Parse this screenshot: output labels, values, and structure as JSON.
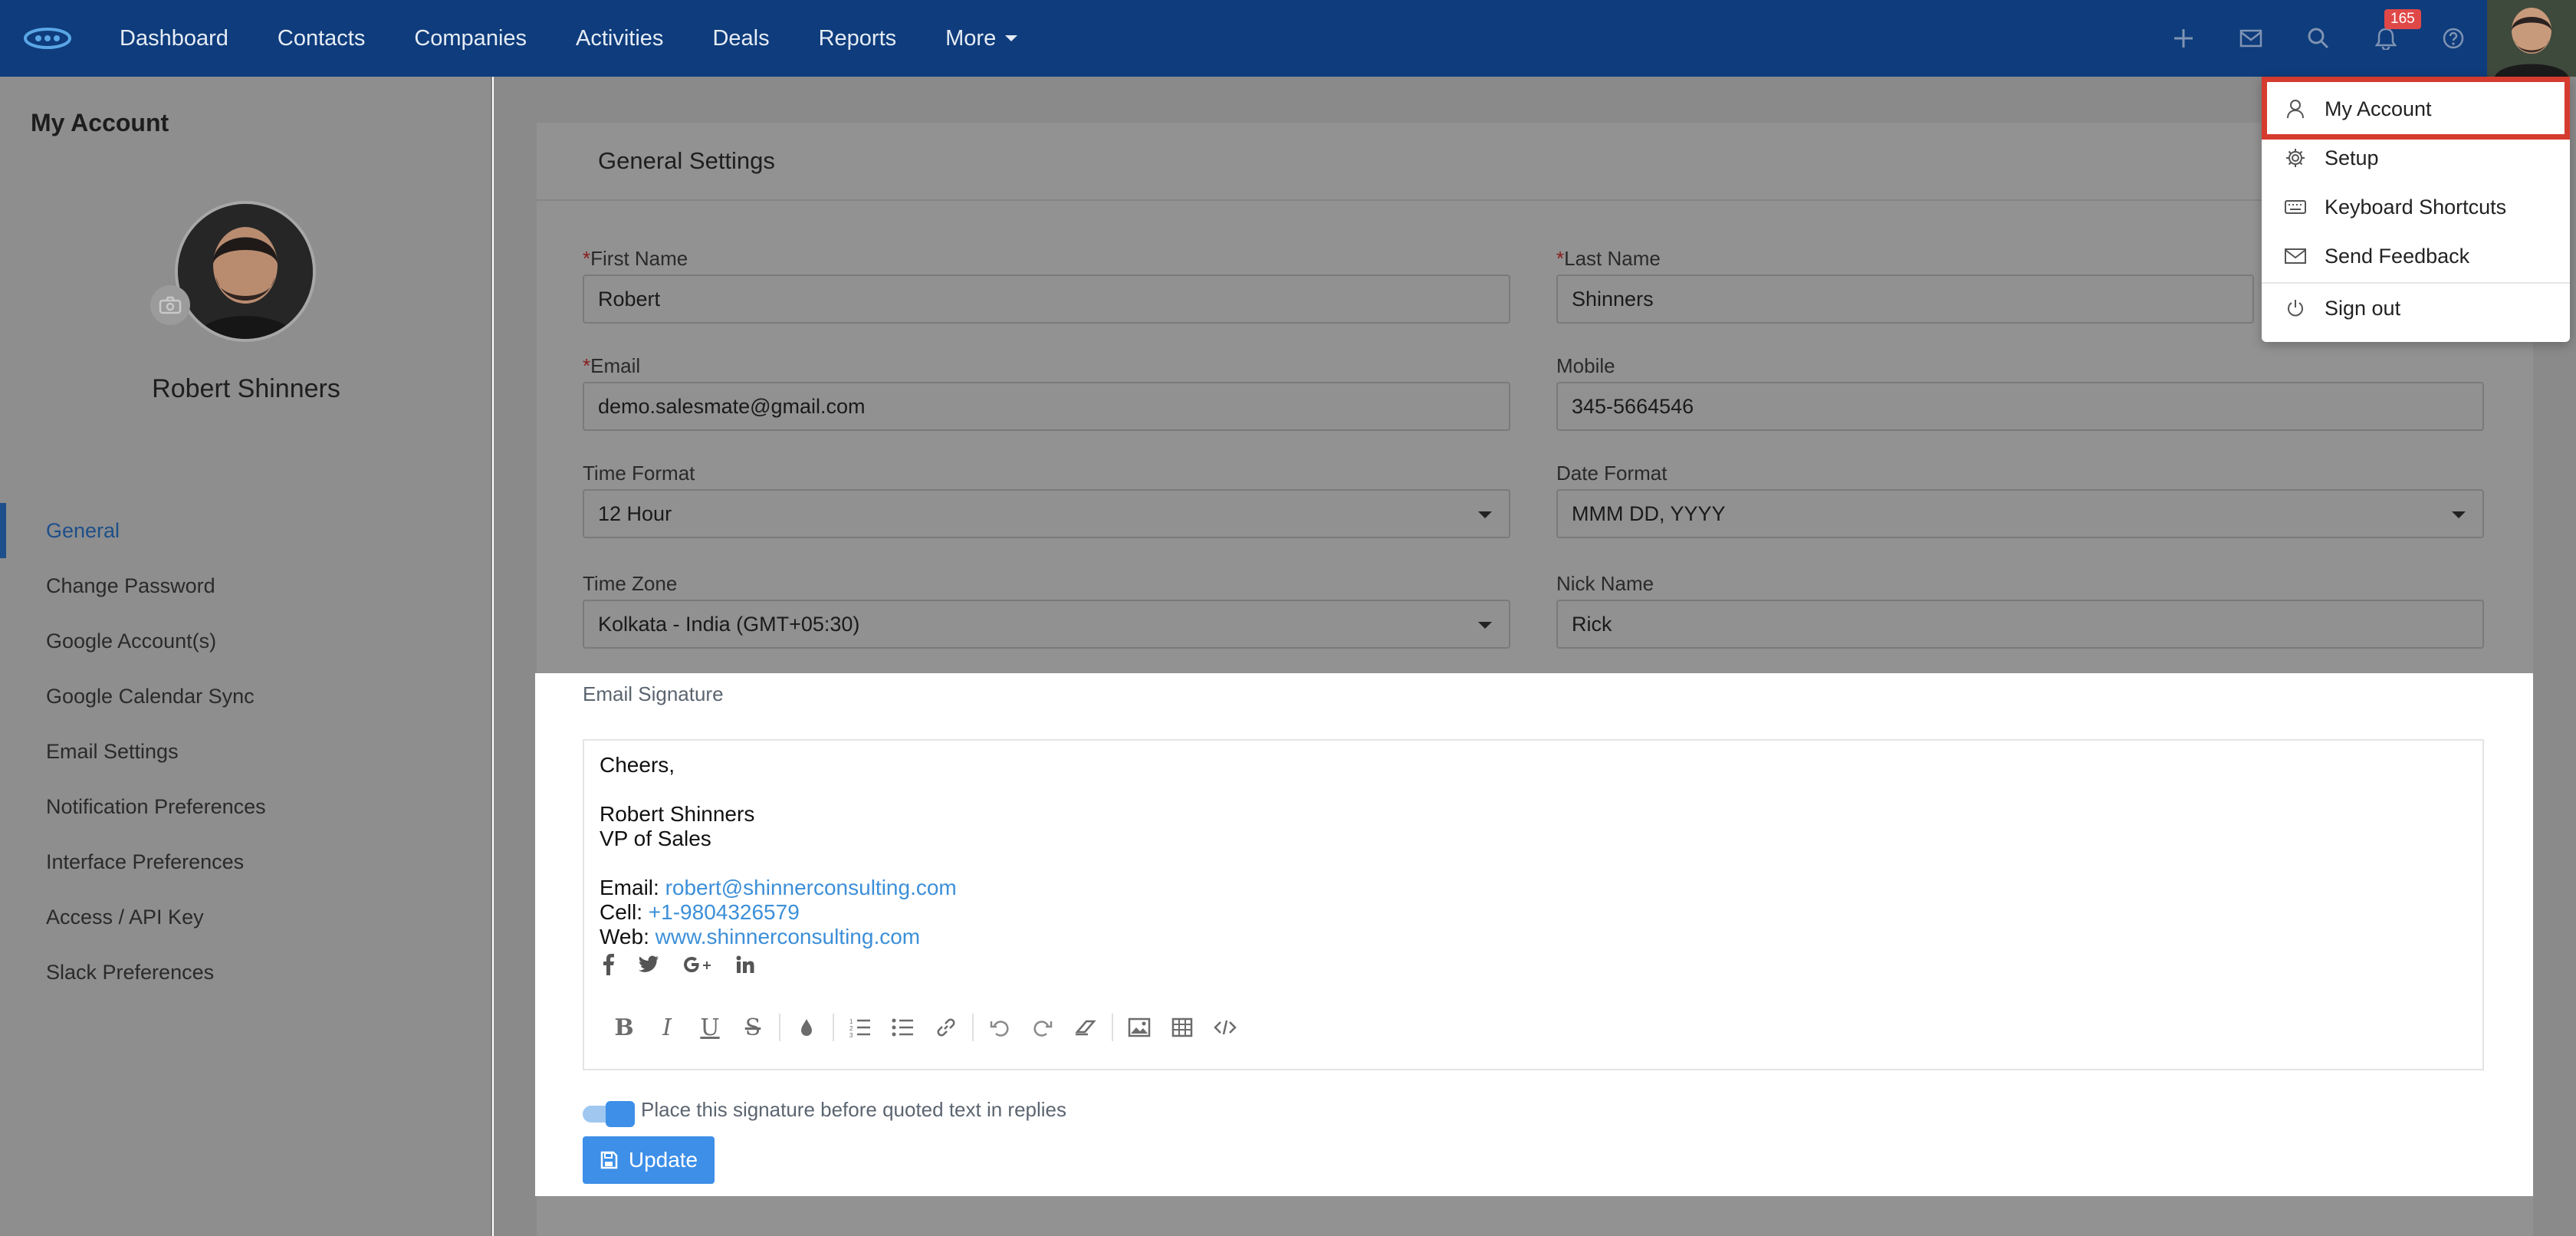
{
  "topbar": {
    "nav": [
      "Dashboard",
      "Contacts",
      "Companies",
      "Activities",
      "Deals",
      "Reports"
    ],
    "more_label": "More",
    "notification_count": "165"
  },
  "sidebar": {
    "title": "My Account",
    "user_name": "Robert Shinners",
    "items": [
      "General",
      "Change Password",
      "Google Account(s)",
      "Google Calendar Sync",
      "Email Settings",
      "Notification Preferences",
      "Interface Preferences",
      "Access / API Key",
      "Slack Preferences"
    ],
    "active_item": "General"
  },
  "general_settings": {
    "title": "General Settings",
    "first_name_label": "First Name",
    "first_name": "Robert",
    "last_name_label": "Last Name",
    "last_name": "Shinners",
    "email_label": "Email",
    "email": "demo.salesmate@gmail.com",
    "mobile_label": "Mobile",
    "mobile": "345-5664546",
    "time_format_label": "Time Format",
    "time_format": "12 Hour",
    "date_format_label": "Date Format",
    "date_format": "MMM DD, YYYY",
    "time_zone_label": "Time Zone",
    "time_zone": "Kolkata - India (GMT+05:30)",
    "nick_name_label": "Nick Name",
    "nick_name": "Rick",
    "required_marker": "*"
  },
  "signature": {
    "label": "Email Signature",
    "greeting": "Cheers,",
    "name": "Robert Shinners",
    "title": "VP of Sales",
    "email_prefix": "Email: ",
    "email": "robert@shinnerconsulting.com",
    "cell_prefix": "Cell: ",
    "cell": "+1-9804326579",
    "web_prefix": "Web: ",
    "web": "www.shinnerconsulting.com",
    "toggle_label": "Place this signature before quoted text in replies",
    "toggle_on": true,
    "update_label": "Update"
  },
  "dropdown": {
    "items": [
      "My Account",
      "Setup",
      "Keyboard Shortcuts",
      "Send Feedback",
      "Sign out"
    ],
    "highlighted": "My Account"
  },
  "colors": {
    "topbar": "#0e3c7c",
    "accent": "#3d8fe8",
    "highlight_border": "#d53b2f",
    "link": "#3c8fd8"
  }
}
